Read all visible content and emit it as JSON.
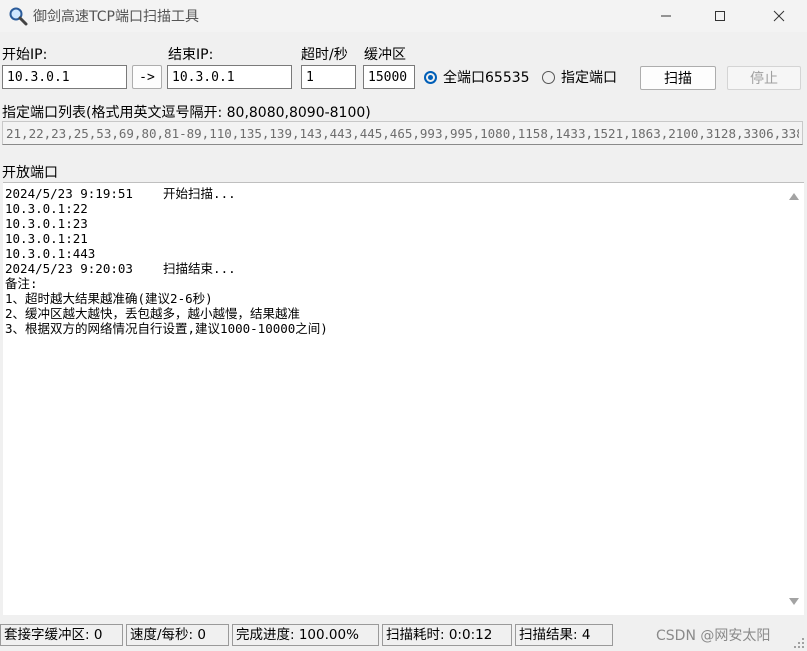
{
  "window": {
    "title": "御剑高速TCP端口扫描工具"
  },
  "form": {
    "start_ip_label": "开始IP:",
    "start_ip_value": "10.3.0.1",
    "arrow_button": "->",
    "end_ip_label": "结束IP:",
    "end_ip_value": "10.3.0.1",
    "timeout_label": "超时/秒",
    "timeout_value": "1",
    "buffer_label": "缓冲区",
    "buffer_value": "15000",
    "radio_all": "全端口65535",
    "radio_all_checked": true,
    "radio_specified": "指定端口",
    "radio_specified_checked": false,
    "scan_button": "扫描",
    "stop_button": "停止",
    "stop_disabled": true,
    "ports_label": "指定端口列表(格式用英文逗号隔开: 80,8080,8090-8100)",
    "ports_value": "21,22,23,25,53,69,80,81-89,110,135,139,143,443,445,465,993,995,1080,1158,1433,1521,1863,2100,3128,3306,338",
    "open_ports_label": "开放端口"
  },
  "log": {
    "lines": [
      "2024/5/23 9:19:51    开始扫描...",
      "10.3.0.1:22",
      "10.3.0.1:23",
      "10.3.0.1:21",
      "10.3.0.1:443",
      "2024/5/23 9:20:03    扫描结束...",
      "备注:",
      "1、超时越大结果越准确(建议2-6秒)",
      "2、缓冲区越大越快，丢包越多，越小越慢，结果越准",
      "3、根据双方的网络情况自行设置,建议1000-10000之间)"
    ]
  },
  "status": {
    "socket_buffer": "套接字缓冲区: 0",
    "speed": "速度/每秒: 0",
    "progress_text": "完成进度: 100.00%",
    "progress": 100,
    "elapsed": "扫描耗时: 0:0:12",
    "results": "扫描结果: 4"
  },
  "watermark": "CSDN @网安太阳",
  "icons": {
    "app": "magnifier-icon",
    "minimize": "minimize-icon",
    "maximize": "maximize-icon",
    "close": "close-icon"
  },
  "colors": {
    "accent": "#005fb8",
    "window_bg": "#f0f0f0",
    "text_area_bg": "#ffffff"
  }
}
